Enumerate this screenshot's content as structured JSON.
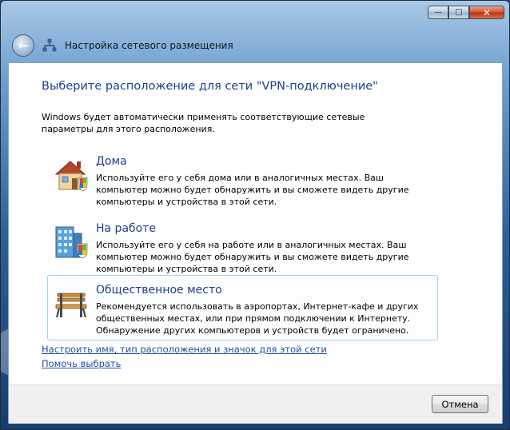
{
  "window": {
    "title": "Настройка сетевого размещения",
    "caption_buttons": {
      "minimize": "—",
      "maximize": "□",
      "close": "✕"
    },
    "back_glyph": "←"
  },
  "heading": "Выберите расположение для сети \"VPN-подключение\"",
  "description": "Windows будет автоматически применять соответствующие сетевые параметры для этого расположения.",
  "options": [
    {
      "title": "Дома",
      "description": "Используйте его у себя дома или в аналогичных местах. Ваш компьютер можно будет обнаружить и вы сможете видеть другие компьютеры и устройства в этой сети.",
      "icon": "home-icon"
    },
    {
      "title": "На работе",
      "description": "Используйте его у себя на работе или в аналогичных местах. Ваш компьютер можно будет обнаружить и вы сможете видеть другие компьютеры и устройства в этой сети.",
      "icon": "office-building-icon"
    },
    {
      "title": "Общественное место",
      "description": "Рекомендуется использовать в аэропортах, Интернет-кафе и других общественных местах, или при прямом подключении к Интернету. Обнаружение других компьютеров и устройств будет ограничено.",
      "icon": "park-bench-icon"
    }
  ],
  "links": {
    "customize": "Настроить имя, тип расположения и значок для этой сети",
    "help": "Помочь выбрать"
  },
  "buttons": {
    "cancel": "Отмена"
  },
  "colors": {
    "heading": "#1e3e8c",
    "link": "#1f4ea3",
    "selected_border": "#9fd3e6"
  }
}
